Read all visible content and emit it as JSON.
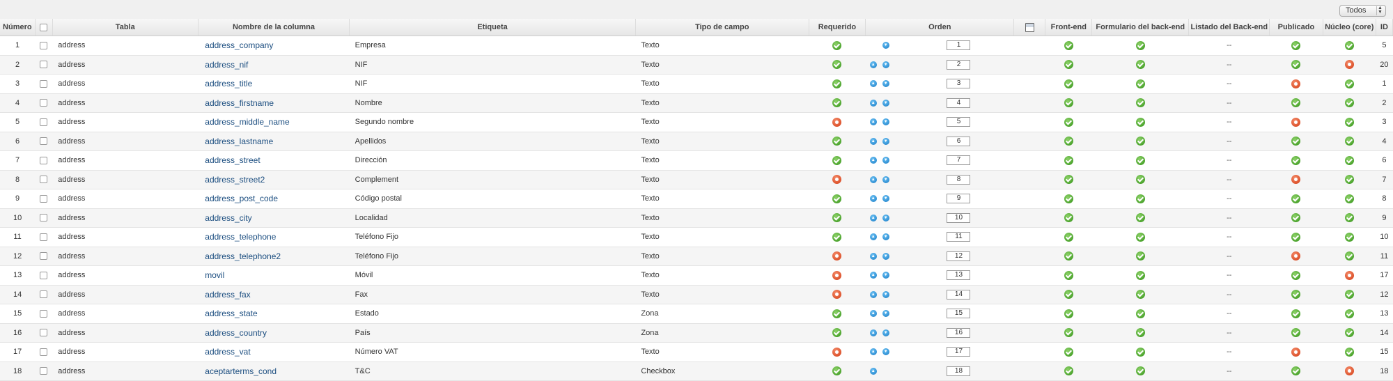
{
  "filter": {
    "label": "Todos"
  },
  "headers": {
    "numero": "Número",
    "tabla": "Tabla",
    "nombre": "Nombre de la columna",
    "etiqueta": "Etiqueta",
    "tipo": "Tipo de campo",
    "requerido": "Requerido",
    "orden": "Orden",
    "frontend": "Front-end",
    "formulario": "Formulario del back-end",
    "listado": "Listado del Back-end",
    "publicado": "Publicado",
    "nucleo": "Núcleo (core)",
    "id": "ID"
  },
  "up_arrow_icon": "arrow-up-circle-icon",
  "down_arrow_icon": "arrow-down-circle-icon",
  "rows": [
    {
      "num": "1",
      "tabla": "address",
      "nombre": "address_company",
      "etiqueta": "Empresa",
      "tipo": "Texto",
      "requerido": true,
      "up": false,
      "down": true,
      "orden": "1",
      "frontend": true,
      "formulario": true,
      "listado": "--",
      "publicado": true,
      "nucleo": true,
      "id": "5"
    },
    {
      "num": "2",
      "tabla": "address",
      "nombre": "address_nif",
      "etiqueta": "NIF",
      "tipo": "Texto",
      "requerido": true,
      "up": true,
      "down": true,
      "orden": "2",
      "frontend": true,
      "formulario": true,
      "listado": "--",
      "publicado": true,
      "nucleo": false,
      "id": "20"
    },
    {
      "num": "3",
      "tabla": "address",
      "nombre": "address_title",
      "etiqueta": "NIF",
      "tipo": "Texto",
      "requerido": true,
      "up": true,
      "down": true,
      "orden": "3",
      "frontend": true,
      "formulario": true,
      "listado": "--",
      "publicado": false,
      "nucleo": true,
      "id": "1"
    },
    {
      "num": "4",
      "tabla": "address",
      "nombre": "address_firstname",
      "etiqueta": "Nombre",
      "tipo": "Texto",
      "requerido": true,
      "up": true,
      "down": true,
      "orden": "4",
      "frontend": true,
      "formulario": true,
      "listado": "--",
      "publicado": true,
      "nucleo": true,
      "id": "2"
    },
    {
      "num": "5",
      "tabla": "address",
      "nombre": "address_middle_name",
      "etiqueta": "Segundo nombre",
      "tipo": "Texto",
      "requerido": false,
      "up": true,
      "down": true,
      "orden": "5",
      "frontend": true,
      "formulario": true,
      "listado": "--",
      "publicado": false,
      "nucleo": true,
      "id": "3"
    },
    {
      "num": "6",
      "tabla": "address",
      "nombre": "address_lastname",
      "etiqueta": "Apellidos",
      "tipo": "Texto",
      "requerido": true,
      "up": true,
      "down": true,
      "orden": "6",
      "frontend": true,
      "formulario": true,
      "listado": "--",
      "publicado": true,
      "nucleo": true,
      "id": "4"
    },
    {
      "num": "7",
      "tabla": "address",
      "nombre": "address_street",
      "etiqueta": "Dirección",
      "tipo": "Texto",
      "requerido": true,
      "up": true,
      "down": true,
      "orden": "7",
      "frontend": true,
      "formulario": true,
      "listado": "--",
      "publicado": true,
      "nucleo": true,
      "id": "6"
    },
    {
      "num": "8",
      "tabla": "address",
      "nombre": "address_street2",
      "etiqueta": "Complement",
      "tipo": "Texto",
      "requerido": false,
      "up": true,
      "down": true,
      "orden": "8",
      "frontend": true,
      "formulario": true,
      "listado": "--",
      "publicado": false,
      "nucleo": true,
      "id": "7"
    },
    {
      "num": "9",
      "tabla": "address",
      "nombre": "address_post_code",
      "etiqueta": "Código postal",
      "tipo": "Texto",
      "requerido": true,
      "up": true,
      "down": true,
      "orden": "9",
      "frontend": true,
      "formulario": true,
      "listado": "--",
      "publicado": true,
      "nucleo": true,
      "id": "8"
    },
    {
      "num": "10",
      "tabla": "address",
      "nombre": "address_city",
      "etiqueta": "Localidad",
      "tipo": "Texto",
      "requerido": true,
      "up": true,
      "down": true,
      "orden": "10",
      "frontend": true,
      "formulario": true,
      "listado": "--",
      "publicado": true,
      "nucleo": true,
      "id": "9"
    },
    {
      "num": "11",
      "tabla": "address",
      "nombre": "address_telephone",
      "etiqueta": "Teléfono Fijo",
      "tipo": "Texto",
      "requerido": true,
      "up": true,
      "down": true,
      "orden": "11",
      "frontend": true,
      "formulario": true,
      "listado": "--",
      "publicado": true,
      "nucleo": true,
      "id": "10"
    },
    {
      "num": "12",
      "tabla": "address",
      "nombre": "address_telephone2",
      "etiqueta": "Teléfono Fijo",
      "tipo": "Texto",
      "requerido": false,
      "up": true,
      "down": true,
      "orden": "12",
      "frontend": true,
      "formulario": true,
      "listado": "--",
      "publicado": false,
      "nucleo": true,
      "id": "11"
    },
    {
      "num": "13",
      "tabla": "address",
      "nombre": "movil",
      "etiqueta": "Móvil",
      "tipo": "Texto",
      "requerido": false,
      "up": true,
      "down": true,
      "orden": "13",
      "frontend": true,
      "formulario": true,
      "listado": "--",
      "publicado": true,
      "nucleo": false,
      "id": "17"
    },
    {
      "num": "14",
      "tabla": "address",
      "nombre": "address_fax",
      "etiqueta": "Fax",
      "tipo": "Texto",
      "requerido": false,
      "up": true,
      "down": true,
      "orden": "14",
      "frontend": true,
      "formulario": true,
      "listado": "--",
      "publicado": true,
      "nucleo": true,
      "id": "12"
    },
    {
      "num": "15",
      "tabla": "address",
      "nombre": "address_state",
      "etiqueta": "Estado",
      "tipo": "Zona",
      "requerido": true,
      "up": true,
      "down": true,
      "orden": "15",
      "frontend": true,
      "formulario": true,
      "listado": "--",
      "publicado": true,
      "nucleo": true,
      "id": "13"
    },
    {
      "num": "16",
      "tabla": "address",
      "nombre": "address_country",
      "etiqueta": "País",
      "tipo": "Zona",
      "requerido": true,
      "up": true,
      "down": true,
      "orden": "16",
      "frontend": true,
      "formulario": true,
      "listado": "--",
      "publicado": true,
      "nucleo": true,
      "id": "14"
    },
    {
      "num": "17",
      "tabla": "address",
      "nombre": "address_vat",
      "etiqueta": "Número VAT",
      "tipo": "Texto",
      "requerido": false,
      "up": true,
      "down": true,
      "orden": "17",
      "frontend": true,
      "formulario": true,
      "listado": "--",
      "publicado": false,
      "nucleo": true,
      "id": "15"
    },
    {
      "num": "18",
      "tabla": "address",
      "nombre": "aceptarterms_cond",
      "etiqueta": "T&C",
      "tipo": "Checkbox",
      "requerido": true,
      "up": true,
      "down": false,
      "orden": "18",
      "frontend": true,
      "formulario": true,
      "listado": "--",
      "publicado": true,
      "nucleo": false,
      "id": "18"
    }
  ]
}
